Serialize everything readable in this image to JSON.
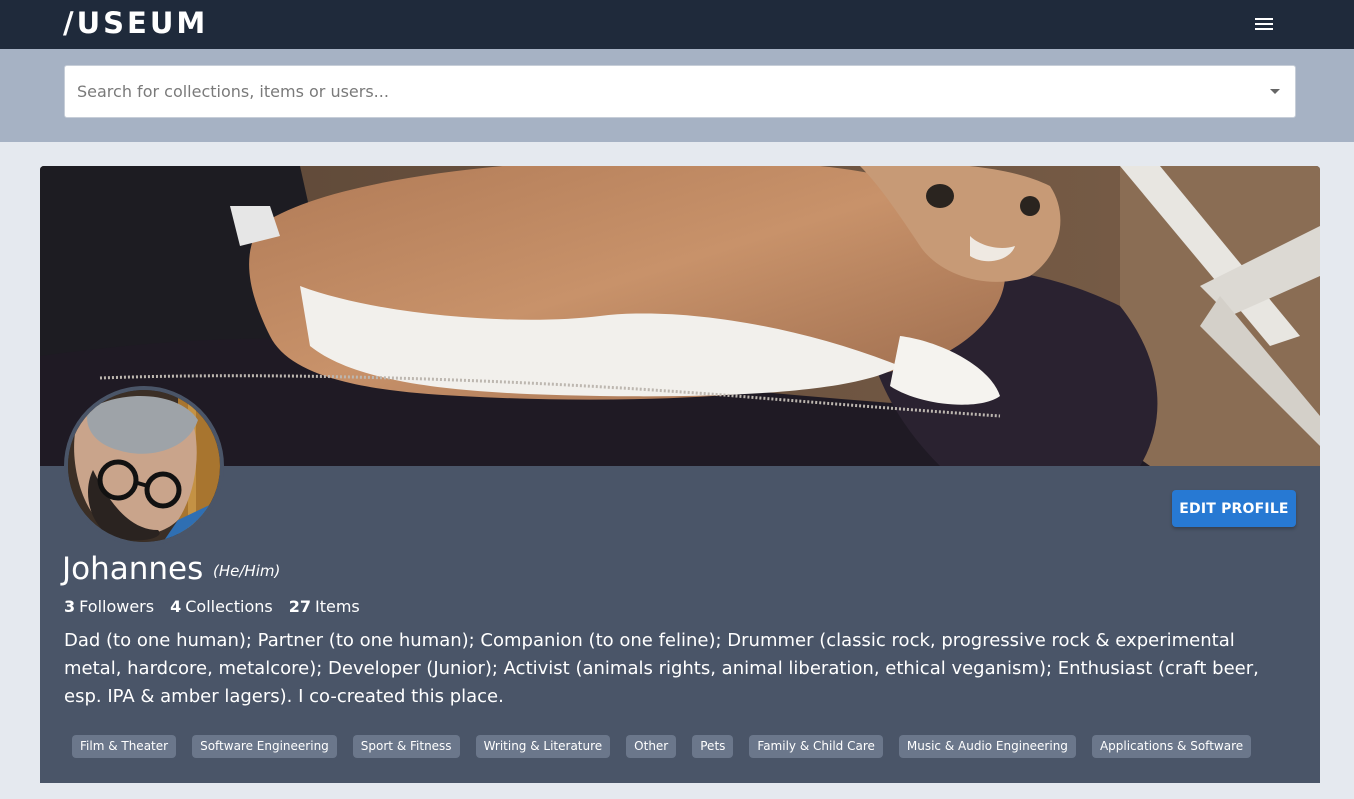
{
  "header": {
    "logo": "/USEUM",
    "menu_icon": "hamburger-menu-icon"
  },
  "search": {
    "placeholder": "Search for collections, items or users...",
    "dropdown_icon": "caret-down-icon"
  },
  "profile": {
    "name": "Johannes",
    "pronouns": "(He/Him)",
    "edit_label": "EDIT PROFILE",
    "stats": [
      {
        "count": "3",
        "label": "Followers"
      },
      {
        "count": "4",
        "label": "Collections"
      },
      {
        "count": "27",
        "label": "Items"
      }
    ],
    "bio": "Dad (to one human); Partner (to one human); Companion (to one feline); Drummer (classic rock, progressive rock & experimental metal, hardcore, metalcore); Developer (Junior); Activist (animals rights, animal liberation, ethical veganism); Enthusiast (craft beer, esp. IPA & amber lagers). I co-created this place.",
    "tags": [
      "Film & Theater",
      "Software Engineering",
      "Sport & Fitness",
      "Writing & Literature",
      "Other",
      "Pets",
      "Family & Child Care",
      "Music & Audio Engineering",
      "Applications & Software"
    ]
  },
  "colors": {
    "topbar": "#1f2a3b",
    "search_band": "#a6b2c4",
    "card": "#4a5568",
    "accent_button": "#2779d3",
    "tag": "#6b778b"
  }
}
